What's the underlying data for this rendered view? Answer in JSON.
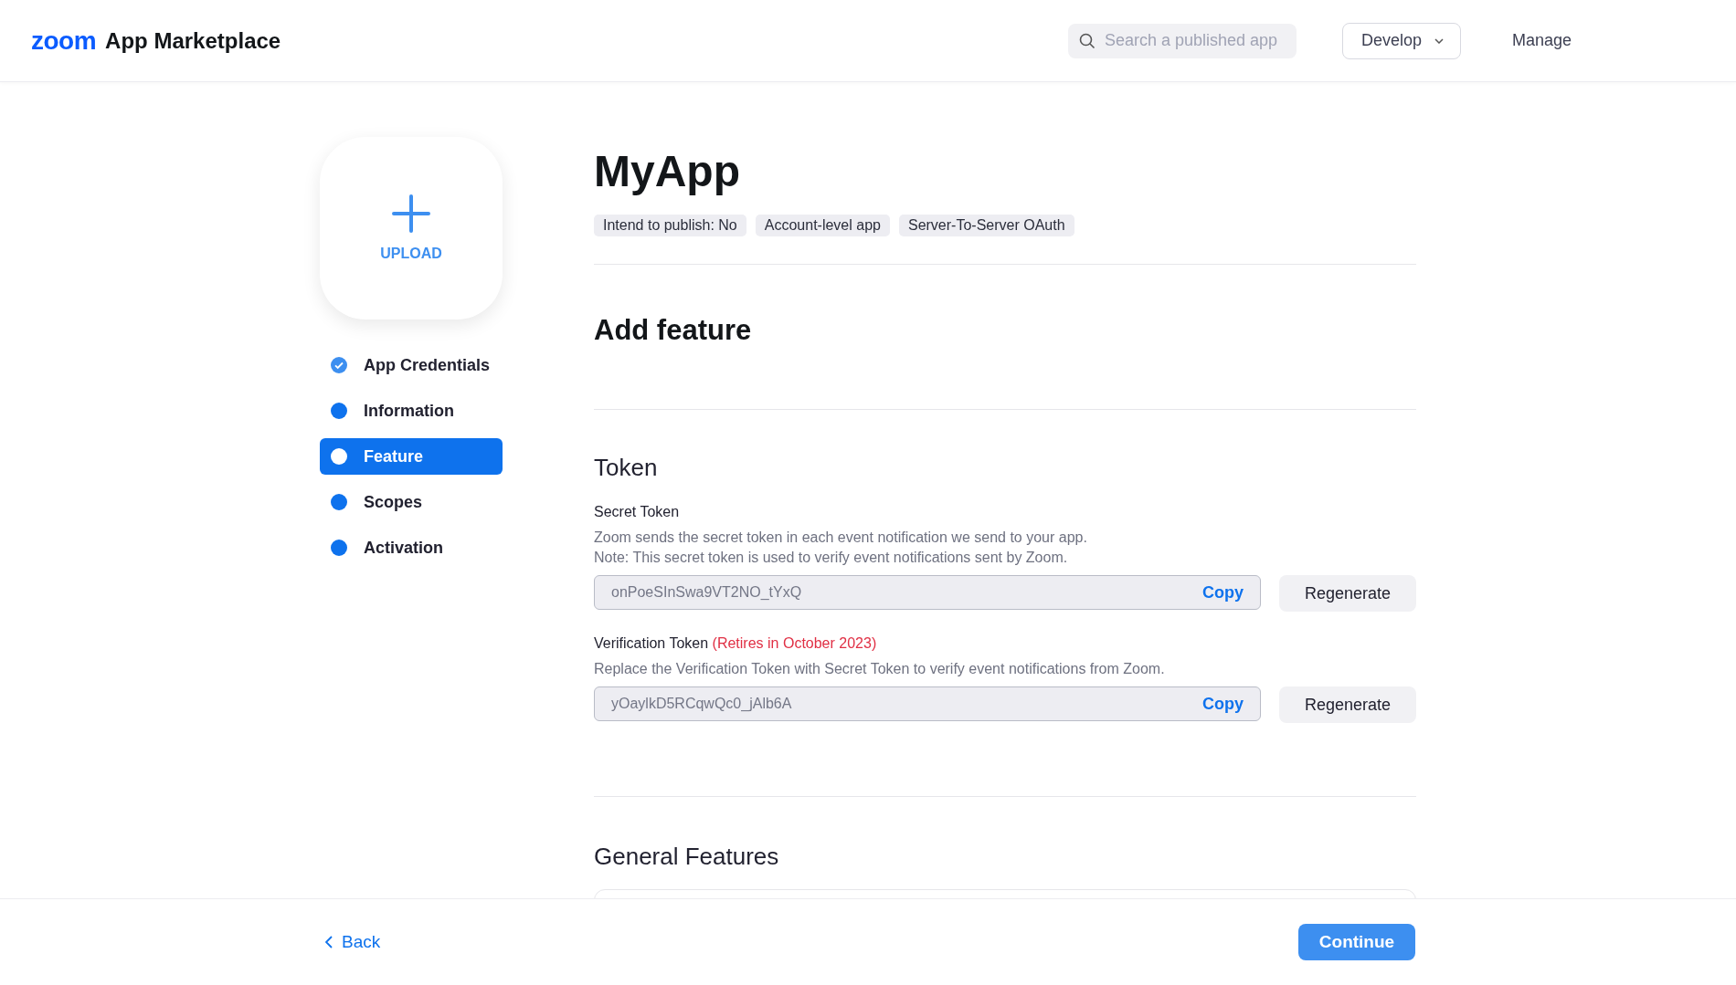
{
  "header": {
    "logo": "zoom",
    "title": "App Marketplace",
    "search": {
      "placeholder": "Search a published app"
    },
    "develop": "Develop",
    "manage": "Manage"
  },
  "upload": {
    "label": "UPLOAD"
  },
  "steps": [
    {
      "label": "App Credentials",
      "completed": true,
      "selected": false
    },
    {
      "label": "Information",
      "completed": false,
      "selected": false
    },
    {
      "label": "Feature",
      "completed": false,
      "selected": true
    },
    {
      "label": "Scopes",
      "completed": false,
      "selected": false
    },
    {
      "label": "Activation",
      "completed": false,
      "selected": false
    }
  ],
  "app": {
    "name": "MyApp",
    "tags": [
      "Intend to publish: No",
      "Account-level app",
      "Server-To-Server OAuth"
    ]
  },
  "section_title": "Add feature",
  "token": {
    "title": "Token",
    "fields": [
      {
        "label": "Secret Token",
        "description": [
          "Zoom sends the secret token in each event notification we send to your app.",
          "Note: This secret token is used to verify event notifications sent by Zoom."
        ],
        "value": "onPoeSInSwa9VT2NO_tYxQ",
        "copy": "Copy",
        "regenerate": "Regenerate"
      },
      {
        "label": "Verification Token",
        "note": "(Retires in October 2023)",
        "description": [
          "Replace the Verification Token with Secret Token to verify event notifications from Zoom."
        ],
        "value": "yOaylkD5RCqwQc0_jAlb6A",
        "copy": "Copy",
        "regenerate": "Regenerate"
      }
    ]
  },
  "general_features": {
    "title": "General Features"
  },
  "footer": {
    "back": "Back",
    "continue": "Continue"
  }
}
